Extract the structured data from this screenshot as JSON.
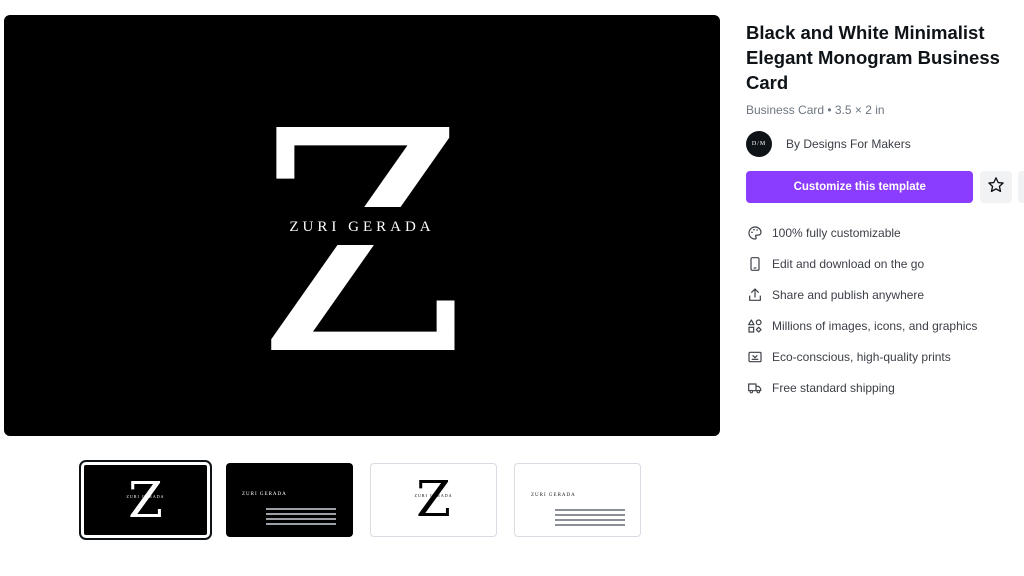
{
  "preview": {
    "monogram_letter": "Z",
    "monogram_name": "ZURI GERADA"
  },
  "thumbnails": [
    {
      "side": "front",
      "theme": "dark",
      "selected": true,
      "letter": "Z",
      "name": "ZURI GERADA"
    },
    {
      "side": "back",
      "theme": "dark",
      "selected": false,
      "name": "ZURI GERADA"
    },
    {
      "side": "front",
      "theme": "light",
      "selected": false,
      "letter": "Z",
      "name": "ZURI GERADA"
    },
    {
      "side": "back",
      "theme": "light",
      "selected": false,
      "name": "ZURI GERADA"
    }
  ],
  "template": {
    "title": "Black and White Minimalist Elegant Monogram Business Card",
    "subtitle": "Business Card • 3.5 × 2 in",
    "author_avatar_initials": "D/M",
    "author": "By Designs For Makers",
    "cta_label": "Customize this template"
  },
  "features": [
    {
      "icon": "palette-icon",
      "text": "100% fully customizable"
    },
    {
      "icon": "phone-icon",
      "text": "Edit and download on the go"
    },
    {
      "icon": "share-icon",
      "text": "Share and publish anywhere"
    },
    {
      "icon": "shapes-icon",
      "text": "Millions of images, icons, and graphics"
    },
    {
      "icon": "print-icon",
      "text": "Eco-conscious, high-quality prints"
    },
    {
      "icon": "truck-icon",
      "text": "Free standard shipping"
    }
  ],
  "colors": {
    "accent": "#8b3dff",
    "card_background": "#000000",
    "text_primary": "#0e1318",
    "text_secondary": "#6e7680"
  }
}
